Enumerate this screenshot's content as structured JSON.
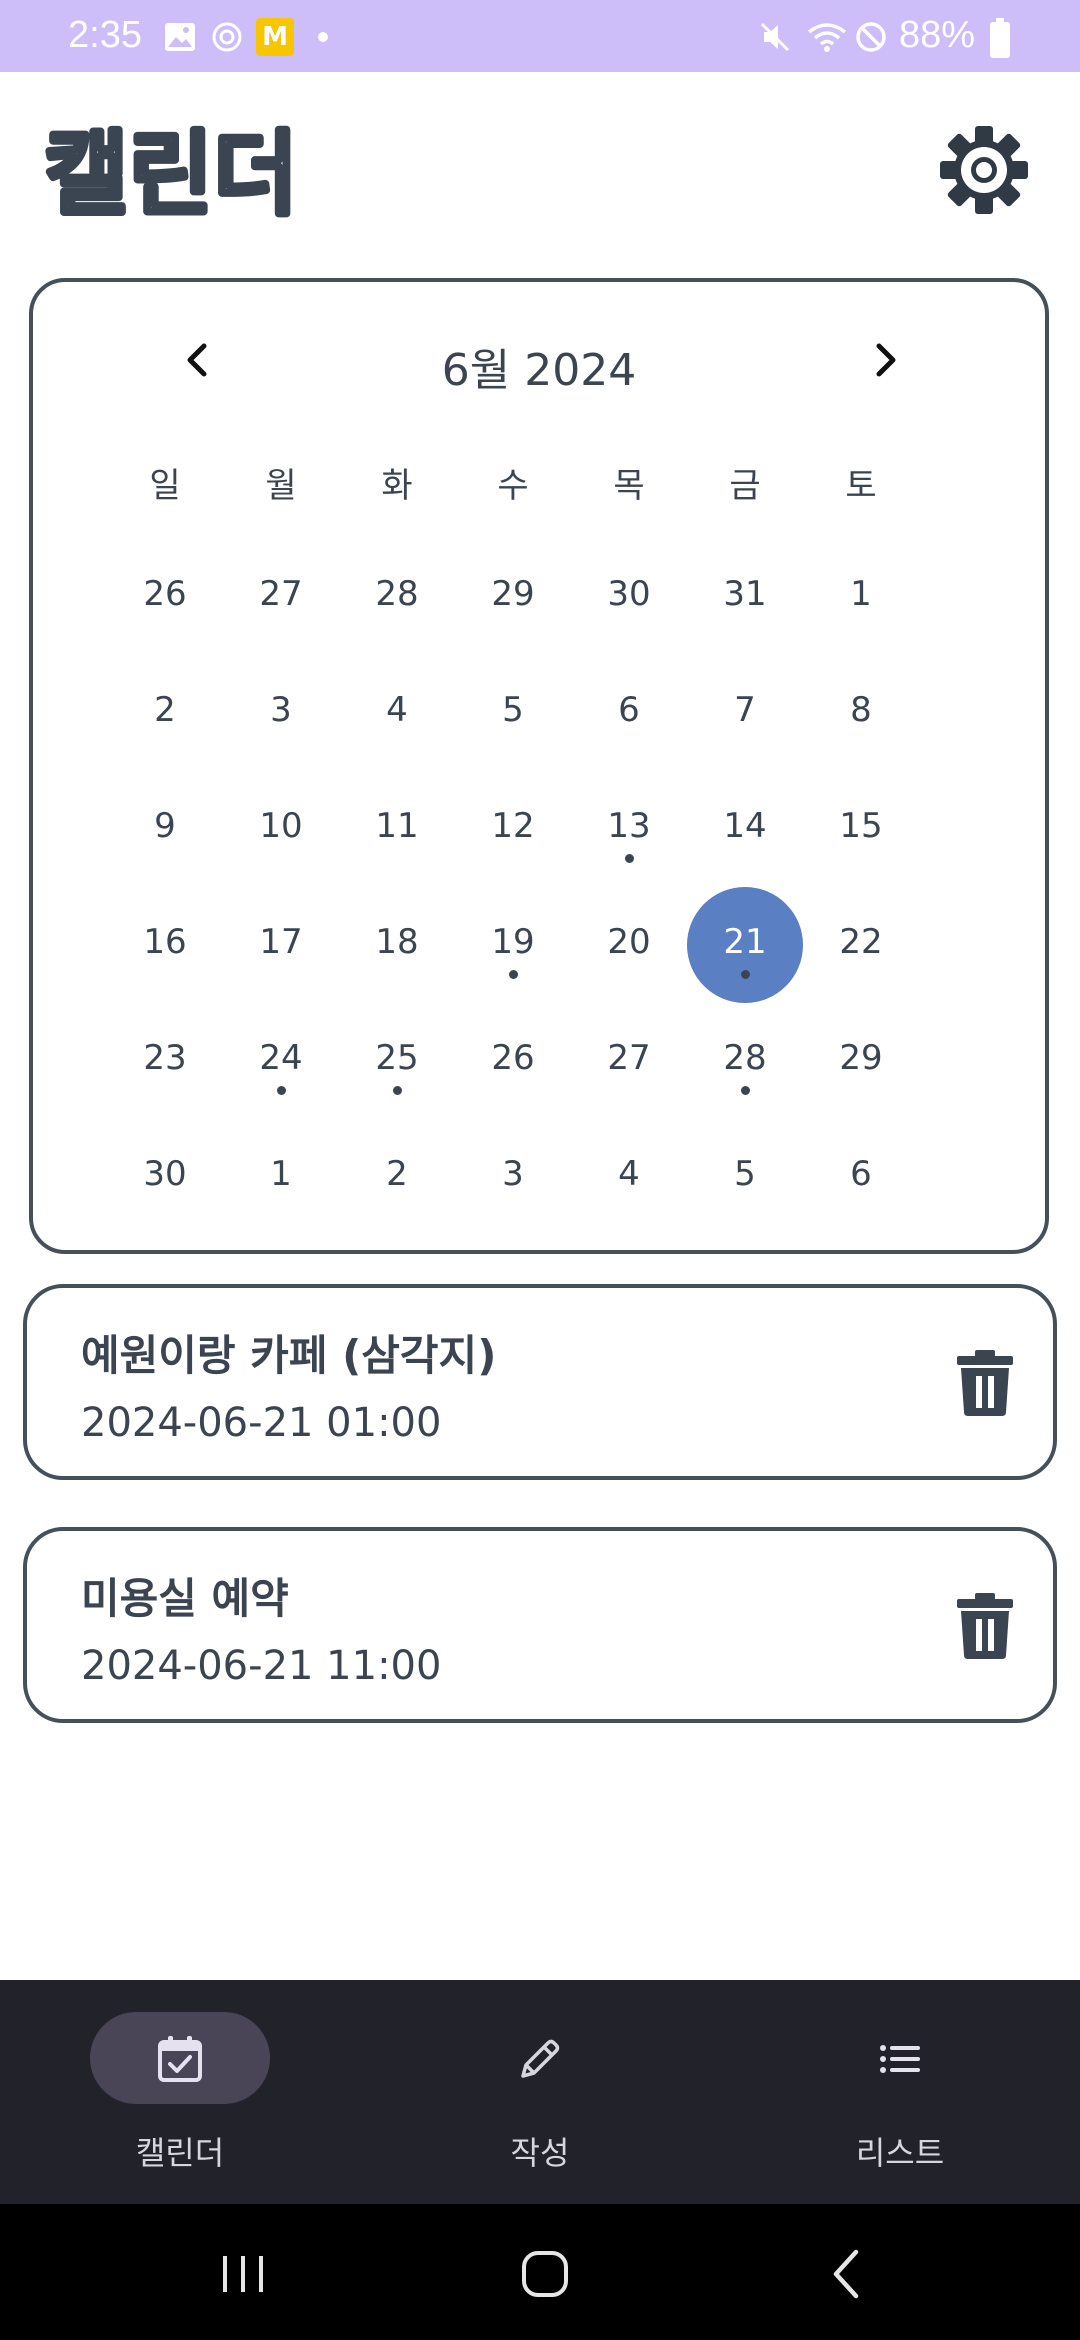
{
  "status_bar": {
    "time": "2:35",
    "mail_badge": "M",
    "battery": "88%"
  },
  "header": {
    "app_logo_text": "캘린더",
    "settings_icon": "gear-icon"
  },
  "calendar": {
    "title": "6월 2024",
    "prev_icon": "chevron-left-icon",
    "next_icon": "chevron-right-icon",
    "weekdays": [
      "일",
      "월",
      "화",
      "수",
      "목",
      "금",
      "토"
    ],
    "weeks": [
      [
        "26",
        "27",
        "28",
        "29",
        "30",
        "31",
        "1"
      ],
      [
        "2",
        "3",
        "4",
        "5",
        "6",
        "7",
        "8"
      ],
      [
        "9",
        "10",
        "11",
        "12",
        "13",
        "14",
        "15"
      ],
      [
        "16",
        "17",
        "18",
        "19",
        "20",
        "21",
        "22"
      ],
      [
        "23",
        "24",
        "25",
        "26",
        "27",
        "28",
        "29"
      ],
      [
        "30",
        "1",
        "2",
        "3",
        "4",
        "5",
        "6"
      ]
    ],
    "selected_day": "21",
    "days_with_events": [
      "13",
      "19",
      "21",
      "24",
      "25",
      "28"
    ],
    "selected_color": "#5a7fc2"
  },
  "events": [
    {
      "title": "예원이랑 카페 (삼각지)",
      "datetime": "2024-06-21 01:00",
      "delete_icon": "trash-icon"
    },
    {
      "title": "미용실 예약",
      "datetime": "2024-06-21 11:00",
      "delete_icon": "trash-icon"
    }
  ],
  "bottom_nav": {
    "items": [
      {
        "label": "캘린더",
        "icon": "calendar-check-icon",
        "active": true
      },
      {
        "label": "작성",
        "icon": "pencil-icon",
        "active": false
      },
      {
        "label": "리스트",
        "icon": "list-icon",
        "active": false
      }
    ]
  },
  "system_nav": {
    "recents_icon": "recents-icon",
    "home_icon": "home-icon",
    "back_icon": "back-icon"
  }
}
